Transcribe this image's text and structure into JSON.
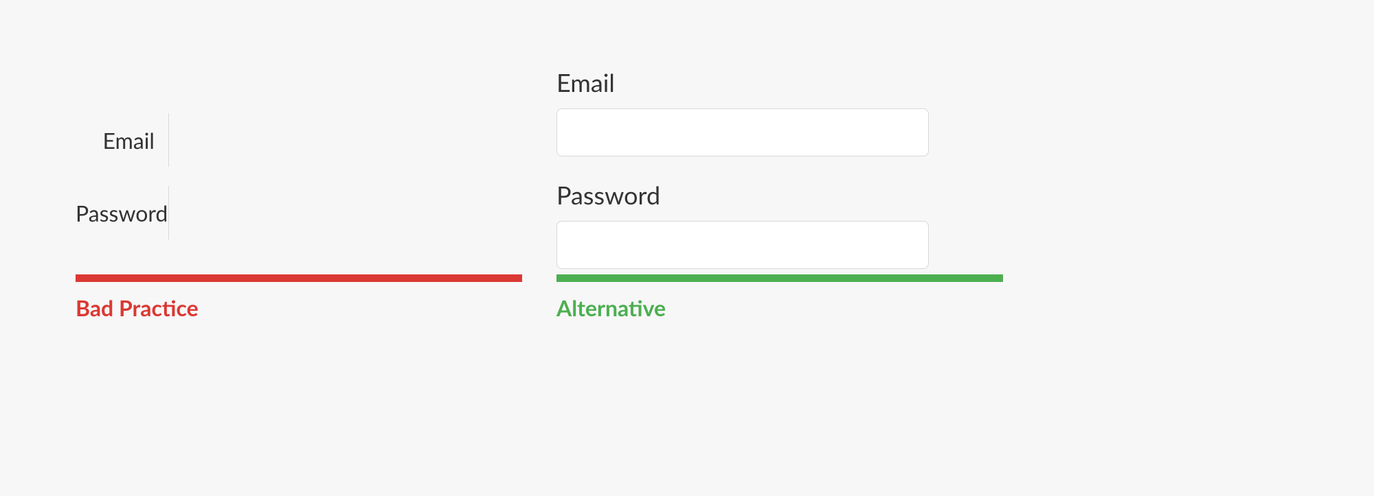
{
  "left": {
    "email_label": "Email",
    "password_label": "Password",
    "caption": "Bad Practice"
  },
  "right": {
    "email_label": "Email",
    "password_label": "Password",
    "email_value": "",
    "password_value": "",
    "caption": "Alternative"
  },
  "colors": {
    "bad": "#db3833",
    "good": "#4caf50"
  }
}
